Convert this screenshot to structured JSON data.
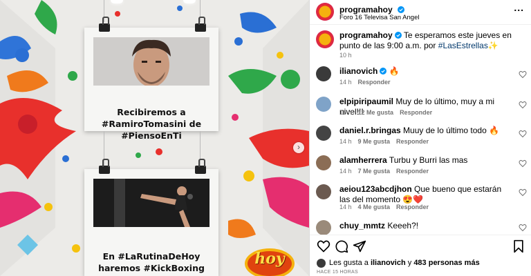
{
  "post": {
    "card1_caption": "Recibiremos a #RamiroTomasini de #PiensoEnTi",
    "card2_caption": "En #LaRutinaDeHoy haremos #KickBoxing",
    "logo_text": "hoy"
  },
  "header": {
    "username": "programahoy",
    "location": "Foro 16 Televisa San Angel",
    "more": "..."
  },
  "caption": {
    "username": "programahoy",
    "text": "Te esperamos este jueves en punto de las 9:00 a.m. por",
    "hashtag": "#LasEstrellas",
    "emoji": "✨",
    "time": "10 h"
  },
  "comments": [
    {
      "username": "ilianovich",
      "verified": true,
      "text": "🔥",
      "time": "14 h",
      "likes": "",
      "reply": "Responder"
    },
    {
      "username": "elpipiripaumil",
      "verified": false,
      "text": "Muy de lo último, muy a mi nivel!!!",
      "time": "15 h",
      "likes": "12 Me gusta",
      "reply": "Responder"
    },
    {
      "username": "daniel.r.bringas",
      "verified": false,
      "text": "Muuy de lo último todo 🔥",
      "time": "14 h",
      "likes": "9 Me gusta",
      "reply": "Responder"
    },
    {
      "username": "alamherrera",
      "verified": false,
      "text": "Turbu y Burri las mas",
      "time": "14 h",
      "likes": "7 Me gusta",
      "reply": "Responder"
    },
    {
      "username": "aeiou123abcdjhon",
      "verified": false,
      "text": "Que bueno que estarán las del momento 😍❤️",
      "time": "14 h",
      "likes": "4 Me gusta",
      "reply": "Responder"
    },
    {
      "username": "chuy_mmtz",
      "verified": false,
      "text": "Keeeh?!",
      "time": "",
      "likes": "",
      "reply": ""
    }
  ],
  "footer": {
    "likes_prefix": "Les gusta a",
    "likes_user": "ilianovich",
    "likes_and": "y",
    "likes_others": "483 personas más",
    "timestamp": "HACE 15 HORAS"
  },
  "colors": {
    "link": "#00376b",
    "verified": "#0095f6",
    "muted": "#737373"
  }
}
